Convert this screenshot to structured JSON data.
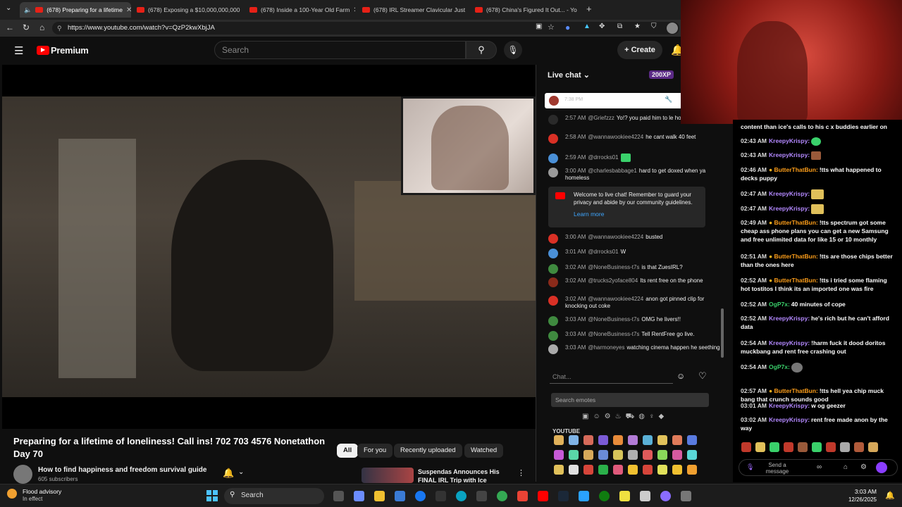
{
  "browser": {
    "tabs": [
      {
        "label": "(678) Preparing for a lifetime",
        "active": true
      },
      {
        "label": "(678) Exposing a $10,000,000,000",
        "active": false
      },
      {
        "label": "(678) Inside a 100-Year Old Farm",
        "active": false
      },
      {
        "label": "(678) IRL Streamer Clavicular Just",
        "active": false
      },
      {
        "label": "(678) China's Figured It Out... - Yo",
        "active": false
      }
    ],
    "url": "https://www.youtube.com/watch?v=QzP2kwXbjJA"
  },
  "youtube": {
    "logo_text": "Premium",
    "search_placeholder": "Search",
    "create_label": "Create",
    "video_title": "Preparing for a lifetime of loneliness! Call ins! 702 703 4576 Nonetathon Day 70",
    "channel_name": "How to find happiness and freedom survival guide",
    "subscribers": "605 subscribers",
    "filters": [
      "All",
      "For you",
      "Recently uploaded",
      "Watched"
    ],
    "suggested_title": "Suspendas Announces His FINAL IRL Trip with Ice"
  },
  "live_chat": {
    "header": "Live chat",
    "xp_badge": "200XP",
    "pinned_time": "7:38 PM",
    "messages": [
      {
        "time": "2:57 AM",
        "user": "@Griefzzz",
        "text": "Yo!? you paid him to le house Anon?",
        "avatar_color": "#2a2a2a"
      },
      {
        "time": "2:58 AM",
        "user": "@wannawookiee4224",
        "text": "he cant walk 40 feet",
        "avatar_color": "#d93025"
      },
      {
        "time": "2:59 AM",
        "user": "@drrocks01",
        "text": "",
        "avatar_color": "#4a8fd6"
      },
      {
        "time": "3:00 AM",
        "user": "@charlesbabbage1",
        "text": "hard to get doxed when ya homeless",
        "avatar_color": "#9a9a9a"
      },
      {
        "time": "3:00 AM",
        "user": "@wannawookiee4224",
        "text": "busted",
        "avatar_color": "#d93025"
      },
      {
        "time": "3:01 AM",
        "user": "@drrocks01",
        "text": "W",
        "avatar_color": "#4a8fd6"
      },
      {
        "time": "3:02 AM",
        "user": "@NoneBusiness-t7s",
        "text": "is that ZuesIRL?",
        "avatar_color": "#3f8a3f"
      },
      {
        "time": "3:02 AM",
        "user": "@trucks2yoface804",
        "text": "Its rent free on the phone",
        "avatar_color": "#8a2a1a"
      },
      {
        "time": "3:02 AM",
        "user": "@wannawookiee4224",
        "text": "anon got pinned clip for knocking out coke",
        "avatar_color": "#d93025"
      },
      {
        "time": "3:03 AM",
        "user": "@NoneBusiness-t7s",
        "text": "OMG he livers!!",
        "avatar_color": "#3f8a3f"
      },
      {
        "time": "3:03 AM",
        "user": "@NoneBusiness-t7s",
        "text": "Tell RentFree go live.",
        "avatar_color": "#3f8a3f"
      },
      {
        "time": "3:03 AM",
        "user": "@harmoneyes",
        "text": "watching cinema happen he seething",
        "avatar_color": "#aaaaaa"
      }
    ],
    "welcome_text": "Welcome to live chat! Remember to guard your privacy and abide by our community guidelines.",
    "learn_more": "Learn more",
    "input_placeholder": "Chat...",
    "emote_search_placeholder": "Search emotes",
    "emote_section": "YOUTUBE"
  },
  "stream_chat": {
    "header_fragment": "content than ice's calls to his c x buddies earlier on",
    "messages": [
      {
        "time": "02:43 AM",
        "user": "KreepyKrispy:",
        "text": "",
        "color": "#b388ff"
      },
      {
        "time": "02:43 AM",
        "user": "KreepyKrispy:",
        "text": "",
        "color": "#b388ff"
      },
      {
        "time": "02:46 AM",
        "user": "ButterThatBun:",
        "text": "!tts what happened to decks puppy",
        "color": "#ff9f1a"
      },
      {
        "time": "02:47 AM",
        "user": "KreepyKrispy:",
        "text": "",
        "color": "#b388ff"
      },
      {
        "time": "02:47 AM",
        "user": "KreepyKrispy:",
        "text": "",
        "color": "#b388ff"
      },
      {
        "time": "02:49 AM",
        "user": "ButterThatBun:",
        "text": "!tts spectrum got some cheap ass phone plans you can get a new Samsung and free unlimited data for like 15 or 10 monthly",
        "color": "#ff9f1a"
      },
      {
        "time": "02:51 AM",
        "user": "ButterThatBun:",
        "text": "!tts are those chips better than the ones here",
        "color": "#ff9f1a"
      },
      {
        "time": "02:52 AM",
        "user": "ButterThatBun:",
        "text": "!tts i tried some flaming hot tostitos I think its an imported one was fire",
        "color": "#ff9f1a"
      },
      {
        "time": "02:52 AM",
        "user": "OgP7x:",
        "text": "40 minutes of cope",
        "color": "#3ad16b"
      },
      {
        "time": "02:52 AM",
        "user": "KreepyKrispy:",
        "text": "he's rich but he can't afford data",
        "color": "#b388ff"
      },
      {
        "time": "02:54 AM",
        "user": "KreepyKrispy:",
        "text": "!harm fuck it dood doritos muckbang and rent free crashing out",
        "color": "#b388ff"
      },
      {
        "time": "02:54 AM",
        "user": "OgP7x:",
        "text": "",
        "color": "#3ad16b"
      },
      {
        "time": "02:57 AM",
        "user": "ButterThatBun:",
        "text": "!tts hell yea chip muck bang that crunch sounds good",
        "color": "#ff9f1a"
      },
      {
        "time": "03:01 AM",
        "user": "KreepyKrispy:",
        "text": "w og geezer",
        "color": "#b388ff"
      },
      {
        "time": "03:02 AM",
        "user": "KreepyKrispy:",
        "text": "rent free made anon by the way",
        "color": "#b388ff"
      }
    ],
    "send_placeholder": "Send a message"
  },
  "taskbar": {
    "weather_title": "Flood advisory",
    "weather_sub": "In effect",
    "search_label": "Search",
    "time": "3:03 AM",
    "date": "12/26/2025"
  }
}
